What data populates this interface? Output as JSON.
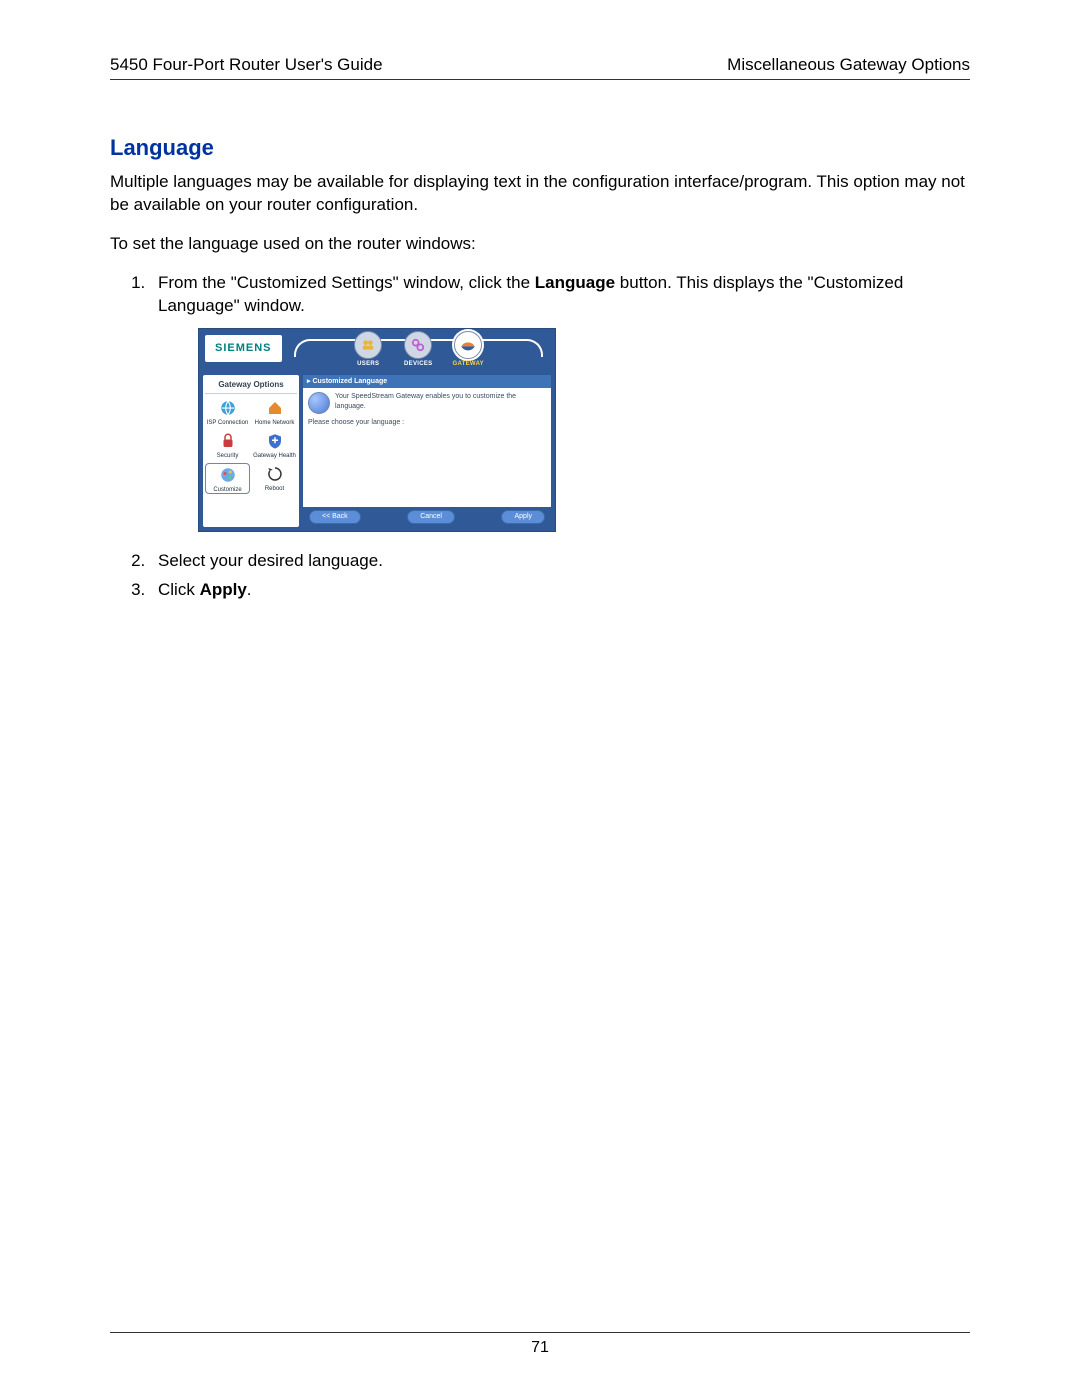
{
  "header": {
    "left": "5450 Four-Port Router User's Guide",
    "right": "Miscellaneous Gateway Options"
  },
  "title": "Language",
  "para1": "Multiple languages may be available for displaying text in the configuration interface/program. This option may not be available on your router configuration.",
  "para2": "To set the language used on the router windows:",
  "steps": {
    "s1_a": "From the \"Customized Settings\" window, click the ",
    "s1_bold": "Language",
    "s1_b": " button. This displays the \"Customized Language\" window.",
    "s2": "Select your desired language.",
    "s3_a": "Click ",
    "s3_bold": "Apply",
    "s3_b": "."
  },
  "ui": {
    "logo": "SIEMENS",
    "tabs": {
      "users": "USERS",
      "devices": "DEVICES",
      "gateway": "GATEWAY"
    },
    "sidebar": {
      "title": "Gateway Options",
      "isp": "ISP Connection",
      "home": "Home Network",
      "security": "Security",
      "health": "Gateway Health",
      "customize": "Customize",
      "reboot": "Reboot"
    },
    "panel": {
      "title": "Customized Language",
      "intro": "Your SpeedStream Gateway enables you to customize the language.",
      "prompt": "Please choose your language :"
    },
    "buttons": {
      "back": "<< Back",
      "cancel": "Cancel",
      "apply": "Apply"
    }
  },
  "page_number": "71"
}
